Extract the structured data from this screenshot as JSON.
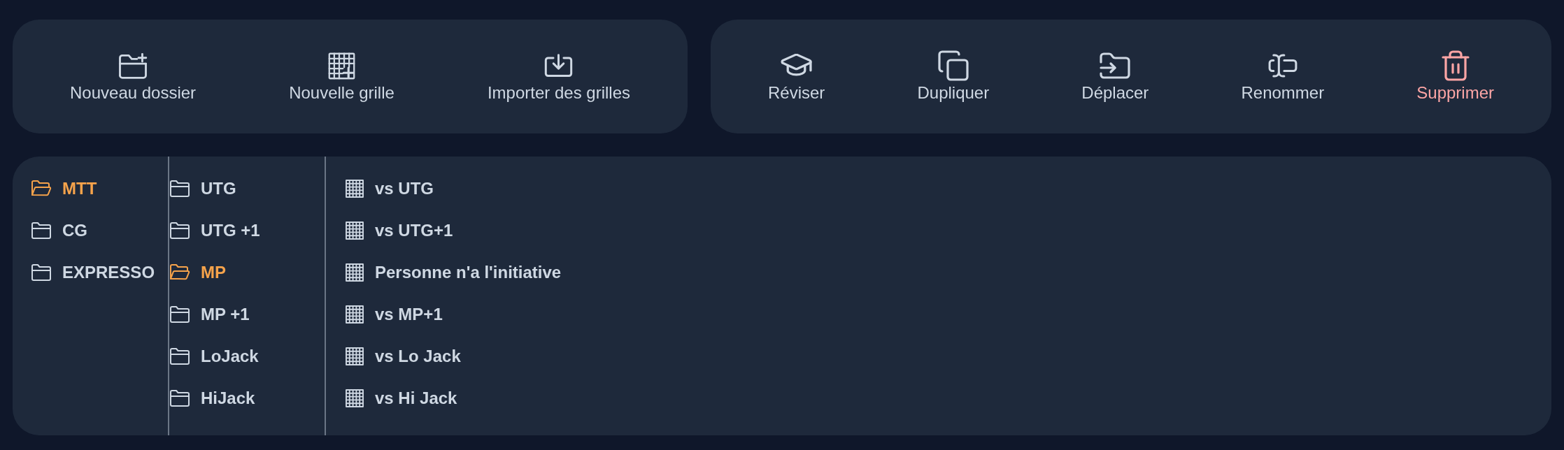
{
  "create_toolbar": {
    "buttons": [
      {
        "kind": "folder",
        "label": "Nouveau dossier"
      },
      {
        "kind": "grid",
        "label": "Nouvelle grille"
      },
      {
        "kind": "import",
        "label": "Importer des grilles"
      }
    ]
  },
  "item_toolbar": {
    "buttons": [
      {
        "kind": "review",
        "label": "Réviser"
      },
      {
        "kind": "duplicate",
        "label": "Dupliquer"
      },
      {
        "kind": "move",
        "label": "Déplacer"
      },
      {
        "kind": "rename",
        "label": "Renommer"
      },
      {
        "kind": "delete",
        "label": "Supprimer"
      }
    ]
  },
  "browser": {
    "items": [
      {
        "kind": "folder",
        "label": "MTT",
        "selected": true,
        "children": [
          {
            "kind": "folder",
            "label": "UTG",
            "selected": false
          },
          {
            "kind": "folder",
            "label": "UTG +1",
            "selected": false
          },
          {
            "kind": "folder",
            "label": "MP",
            "selected": true,
            "children": [
              {
                "kind": "grid",
                "label": "vs UTG",
                "selected": false
              },
              {
                "kind": "grid",
                "label": "vs UTG+1",
                "selected": false
              },
              {
                "kind": "grid",
                "label": "Personne n'a l'initiative",
                "selected": false
              },
              {
                "kind": "grid",
                "label": "vs MP+1",
                "selected": false
              },
              {
                "kind": "grid",
                "label": "vs Lo Jack",
                "selected": false
              },
              {
                "kind": "grid",
                "label": "vs Hi Jack",
                "selected": false
              }
            ]
          },
          {
            "kind": "folder",
            "label": "MP +1",
            "selected": false
          },
          {
            "kind": "folder",
            "label": "LoJack",
            "selected": false
          },
          {
            "kind": "folder",
            "label": "HiJack",
            "selected": false
          }
        ]
      },
      {
        "kind": "folder",
        "label": "CG",
        "selected": false
      },
      {
        "kind": "folder",
        "label": "EXPRESSO",
        "selected": false
      }
    ]
  }
}
